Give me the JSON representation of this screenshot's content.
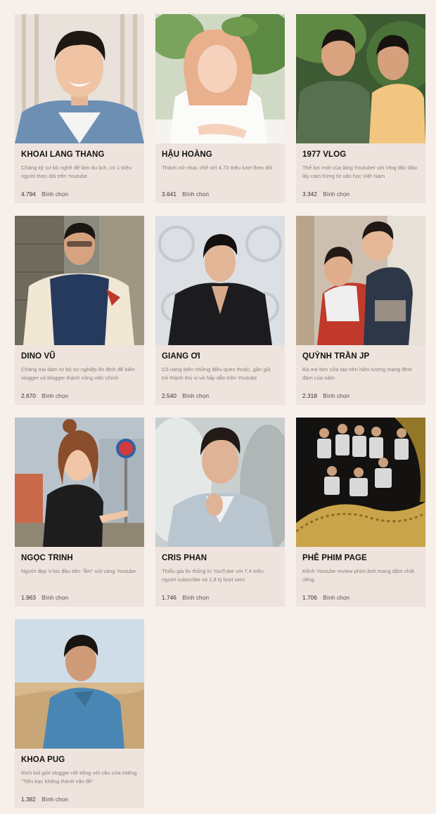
{
  "vote_label": "Bình chọn",
  "cards": [
    {
      "name": "KHOAI LANG THANG",
      "desc": "Chàng kỹ sư bỏ nghề để làm du lịch, có 1 triệu người theo dõi trên Youtube",
      "votes": "4.794"
    },
    {
      "name": "HẬU HOÀNG",
      "desc": "Thánh nữ nhạc chế với 4,73 triệu lượt theo dõi",
      "votes": "3.641"
    },
    {
      "name": "1977 VLOG",
      "desc": "Thế lực mới của làng Youtuber với Vlog độc đáo lấy cảm hứng từ văn học Việt Nam",
      "votes": "3.342"
    },
    {
      "name": "DINO VŨ",
      "desc": "Chàng trai dám từ bỏ sự nghiệp ổn định để biến vlogger và blogger thành công việc chính",
      "votes": "2.670"
    },
    {
      "name": "GIANG ƠI",
      "desc": "Cô nàng biến những điều quen thuộc, gần gũi trở thành thú vị và hấp dẫn trên Youtube",
      "votes": "2.540"
    },
    {
      "name": "QUỲNH TRẦN JP",
      "desc": "Bà mẹ bỉm sữa tạo nên hiện tượng mạng đình đám của năm",
      "votes": "2.318"
    },
    {
      "name": "NGỌC TRINH",
      "desc": "Người đẹp V-biz đầu tiên \"ẵm\" nút vàng Youtube",
      "votes": "1.963"
    },
    {
      "name": "CRIS PHAN",
      "desc": "Thiếu gia 9x thống trị YouTube với 7,4 triệu người subscribe và 1,8 tỷ lượt xem",
      "votes": "1.746"
    },
    {
      "name": "PHÊ PHIM PAGE",
      "desc": "Kênh Youtube review phim ảnh mang đậm chất riêng",
      "votes": "1.706"
    },
    {
      "name": "KHOA PUG",
      "desc": "Rich kid giới vlogger nổi tiếng với câu cửa miệng \"Tiền bạc không thành vấn đề\"",
      "votes": "1.382"
    }
  ]
}
